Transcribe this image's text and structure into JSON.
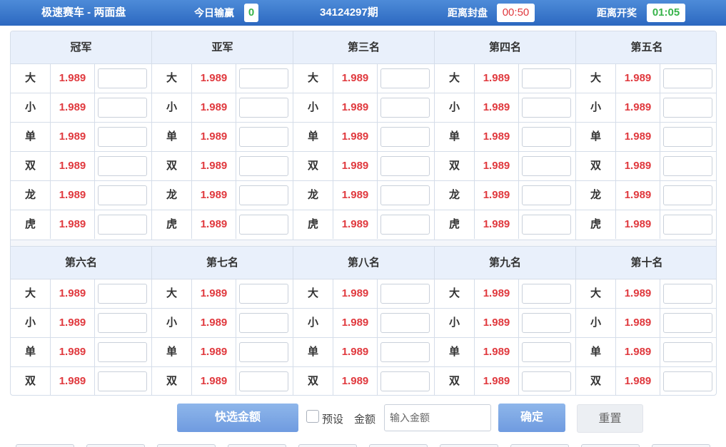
{
  "header": {
    "title": "极速赛车 - 两面盘",
    "today_label": "今日输赢",
    "today_value": "0",
    "issue": "34124297期",
    "close_label": "距离封盘",
    "close_value": "00:50",
    "draw_label": "距离开奖",
    "draw_value": "01:05",
    "colors": {
      "bar": "#3a78cc",
      "today": "#37b34a",
      "close": "#e0393e",
      "draw": "#37b34a"
    }
  },
  "sections": [
    {
      "columns": [
        {
          "title": "冠军",
          "rows": [
            {
              "label": "大",
              "odds": "1.989"
            },
            {
              "label": "小",
              "odds": "1.989"
            },
            {
              "label": "单",
              "odds": "1.989"
            },
            {
              "label": "双",
              "odds": "1.989"
            },
            {
              "label": "龙",
              "odds": "1.989"
            },
            {
              "label": "虎",
              "odds": "1.989"
            }
          ]
        },
        {
          "title": "亚军",
          "rows": [
            {
              "label": "大",
              "odds": "1.989"
            },
            {
              "label": "小",
              "odds": "1.989"
            },
            {
              "label": "单",
              "odds": "1.989"
            },
            {
              "label": "双",
              "odds": "1.989"
            },
            {
              "label": "龙",
              "odds": "1.989"
            },
            {
              "label": "虎",
              "odds": "1.989"
            }
          ]
        },
        {
          "title": "第三名",
          "rows": [
            {
              "label": "大",
              "odds": "1.989"
            },
            {
              "label": "小",
              "odds": "1.989"
            },
            {
              "label": "单",
              "odds": "1.989"
            },
            {
              "label": "双",
              "odds": "1.989"
            },
            {
              "label": "龙",
              "odds": "1.989"
            },
            {
              "label": "虎",
              "odds": "1.989"
            }
          ]
        },
        {
          "title": "第四名",
          "rows": [
            {
              "label": "大",
              "odds": "1.989"
            },
            {
              "label": "小",
              "odds": "1.989"
            },
            {
              "label": "单",
              "odds": "1.989"
            },
            {
              "label": "双",
              "odds": "1.989"
            },
            {
              "label": "龙",
              "odds": "1.989"
            },
            {
              "label": "虎",
              "odds": "1.989"
            }
          ]
        },
        {
          "title": "第五名",
          "rows": [
            {
              "label": "大",
              "odds": "1.989"
            },
            {
              "label": "小",
              "odds": "1.989"
            },
            {
              "label": "单",
              "odds": "1.989"
            },
            {
              "label": "双",
              "odds": "1.989"
            },
            {
              "label": "龙",
              "odds": "1.989"
            },
            {
              "label": "虎",
              "odds": "1.989"
            }
          ]
        }
      ]
    },
    {
      "columns": [
        {
          "title": "第六名",
          "rows": [
            {
              "label": "大",
              "odds": "1.989"
            },
            {
              "label": "小",
              "odds": "1.989"
            },
            {
              "label": "单",
              "odds": "1.989"
            },
            {
              "label": "双",
              "odds": "1.989"
            }
          ]
        },
        {
          "title": "第七名",
          "rows": [
            {
              "label": "大",
              "odds": "1.989"
            },
            {
              "label": "小",
              "odds": "1.989"
            },
            {
              "label": "单",
              "odds": "1.989"
            },
            {
              "label": "双",
              "odds": "1.989"
            }
          ]
        },
        {
          "title": "第八名",
          "rows": [
            {
              "label": "大",
              "odds": "1.989"
            },
            {
              "label": "小",
              "odds": "1.989"
            },
            {
              "label": "单",
              "odds": "1.989"
            },
            {
              "label": "双",
              "odds": "1.989"
            }
          ]
        },
        {
          "title": "第九名",
          "rows": [
            {
              "label": "大",
              "odds": "1.989"
            },
            {
              "label": "小",
              "odds": "1.989"
            },
            {
              "label": "单",
              "odds": "1.989"
            },
            {
              "label": "双",
              "odds": "1.989"
            }
          ]
        },
        {
          "title": "第十名",
          "rows": [
            {
              "label": "大",
              "odds": "1.989"
            },
            {
              "label": "小",
              "odds": "1.989"
            },
            {
              "label": "单",
              "odds": "1.989"
            },
            {
              "label": "双",
              "odds": "1.989"
            }
          ]
        }
      ]
    }
  ],
  "footer": {
    "quick_amount_label": "快选金额",
    "preset_label": "预设",
    "amount_label": "金额",
    "amount_placeholder": "输入金额",
    "confirm_label": "确定",
    "reset_label": "重置",
    "preset_checked": false
  }
}
